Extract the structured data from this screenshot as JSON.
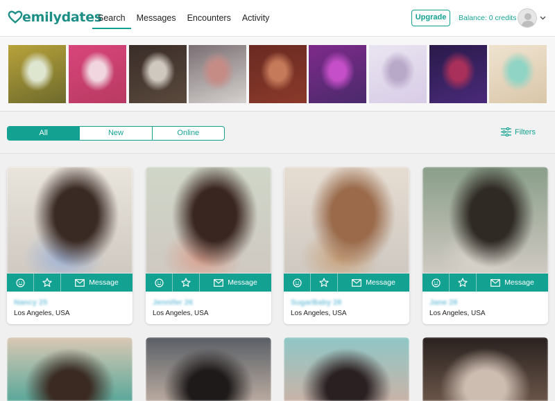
{
  "header": {
    "logo_text": "emilydates",
    "nav": [
      {
        "label": "Search",
        "active": true
      },
      {
        "label": "Messages",
        "active": false
      },
      {
        "label": "Encounters",
        "active": false
      },
      {
        "label": "Activity",
        "active": false
      }
    ],
    "upgrade_label": "Upgrade",
    "balance_text": "Balance: 0 credits"
  },
  "strip_colors": [
    [
      "#b8a23a",
      "#dfe6d0",
      "#6d6a2c"
    ],
    [
      "#d8457a",
      "#f1d6df",
      "#b83a62"
    ],
    [
      "#3a2c28",
      "#cfc8bf",
      "#5a4a3d"
    ],
    [
      "#7a6f73",
      "#c58c86",
      "#d6d2cf"
    ],
    [
      "#6a2a22",
      "#c57a5a",
      "#8a3a2a"
    ],
    [
      "#7e2a8a",
      "#c44fc8",
      "#4a2a6b"
    ],
    [
      "#e9e4f1",
      "#b9a9c9",
      "#d8cce6"
    ],
    [
      "#2a1a4a",
      "#a8305a",
      "#4a2a7a"
    ],
    [
      "#efe3cf",
      "#8fd4c4",
      "#d9c6a9"
    ]
  ],
  "segments": [
    {
      "label": "All",
      "active": true
    },
    {
      "label": "New",
      "active": false
    },
    {
      "label": "Online",
      "active": false
    }
  ],
  "filters_label": "Filters",
  "message_label": "Message",
  "cards": [
    {
      "name": "Nancy 25",
      "location": "Los Angeles, USA",
      "colors": [
        "#e9e4dc",
        "#3a2a24",
        "#9fb3d6"
      ]
    },
    {
      "name": "Jennifer 26",
      "location": "Los Angeles, USA",
      "colors": [
        "#cfd6c8",
        "#3a2620",
        "#d9a08e"
      ]
    },
    {
      "name": "SugarBaby 28",
      "location": "Los Angeles, USA",
      "colors": [
        "#e6ddd2",
        "#9a6a4a",
        "#c8a27c"
      ]
    },
    {
      "name": "Jane 28",
      "location": "Los Angeles, USA",
      "colors": [
        "#8a9f8a",
        "#2f2a24",
        "#d9d4cc"
      ]
    }
  ],
  "cards_row2_colors": [
    [
      "#d9c8b4",
      "#3a2a22",
      "#5aa89a"
    ],
    [
      "#5a5f66",
      "#1e1a1a",
      "#b9aaa0"
    ],
    [
      "#8fc7c6",
      "#2a2022",
      "#c9b3a8"
    ],
    [
      "#2a2220",
      "#cdbdb1",
      "#6a5548"
    ]
  ],
  "accent": "#13a192"
}
